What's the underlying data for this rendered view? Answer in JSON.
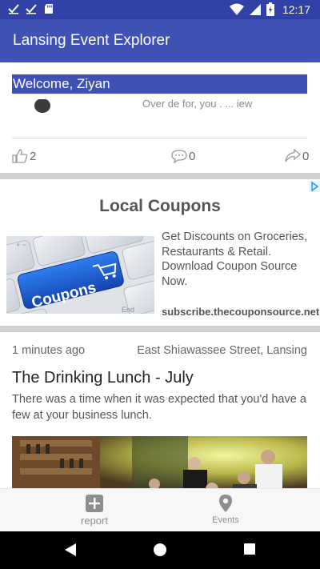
{
  "status_bar": {
    "time": "12:17",
    "left_icons": [
      "check-icon",
      "check-icon",
      "sd-card-icon"
    ],
    "right_icons": [
      "wifi-icon",
      "signal-icon",
      "battery-icon"
    ]
  },
  "app_bar": {
    "title": "Lansing Event Explorer"
  },
  "welcome": {
    "text": "Welcome, Ziyan"
  },
  "previous_card": {
    "partial_text": "Over de for, you . ... iew",
    "likes": "2",
    "comments": "0",
    "shares": "0"
  },
  "ad": {
    "title": "Local Coupons",
    "image_text": "Coupons",
    "copy": "Get Discounts on Groceries, Restaurants & Retail. Download Coupon Source Now.",
    "url": "subscribe.thecouponsource.net"
  },
  "event": {
    "time_ago": "1 minutes ago",
    "location": "East Shiawassee Street, Lansing",
    "title": "The Drinking Lunch - July",
    "description": "There was a time when it was expected that you'd have a few at your business lunch."
  },
  "bottom_nav": {
    "report_label": "report",
    "events_label": "Events"
  },
  "colors": {
    "primary": "#3f51b5",
    "status_bar": "#3141a8",
    "coupon_blue": "#1f5fd1"
  }
}
